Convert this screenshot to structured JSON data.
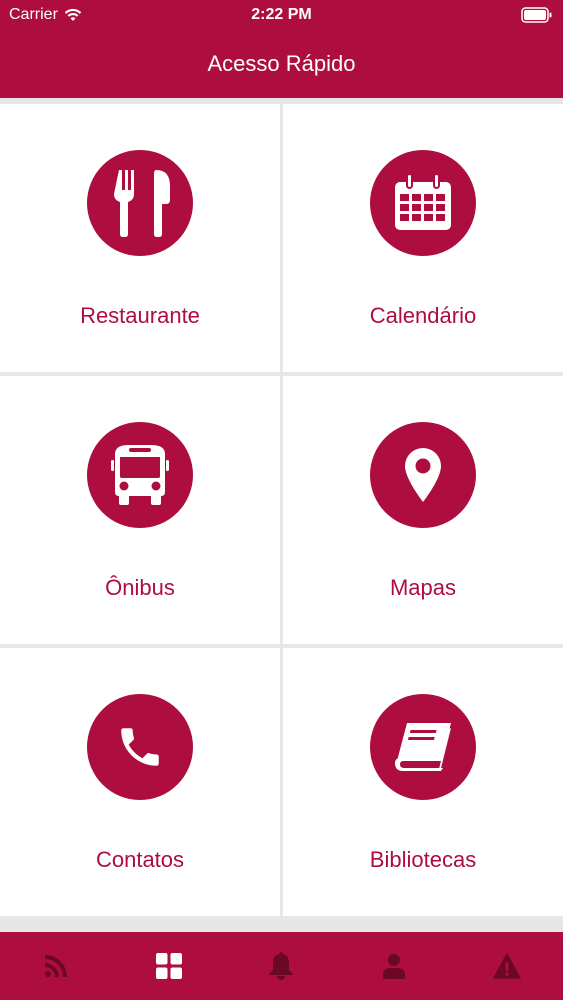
{
  "status_bar": {
    "carrier": "Carrier",
    "time": "2:22 PM"
  },
  "header": {
    "title": "Acesso Rápido"
  },
  "tiles": [
    {
      "label": "Restaurante",
      "icon": "fork-knife-icon"
    },
    {
      "label": "Calendário",
      "icon": "calendar-icon"
    },
    {
      "label": "Ônibus",
      "icon": "bus-icon"
    },
    {
      "label": "Mapas",
      "icon": "map-pin-icon"
    },
    {
      "label": "Contatos",
      "icon": "phone-icon"
    },
    {
      "label": "Bibliotecas",
      "icon": "book-icon"
    }
  ],
  "tab_bar": {
    "items": [
      {
        "icon": "rss-feed-icon",
        "active": false
      },
      {
        "icon": "grid-icon",
        "active": true
      },
      {
        "icon": "bell-icon",
        "active": false
      },
      {
        "icon": "user-icon",
        "active": false
      },
      {
        "icon": "warning-icon",
        "active": false
      }
    ]
  },
  "colors": {
    "brand": "#ad0e3f",
    "tab_inactive": "#6b0826",
    "tab_active": "#ffffff",
    "background": "#e6e6e6"
  }
}
